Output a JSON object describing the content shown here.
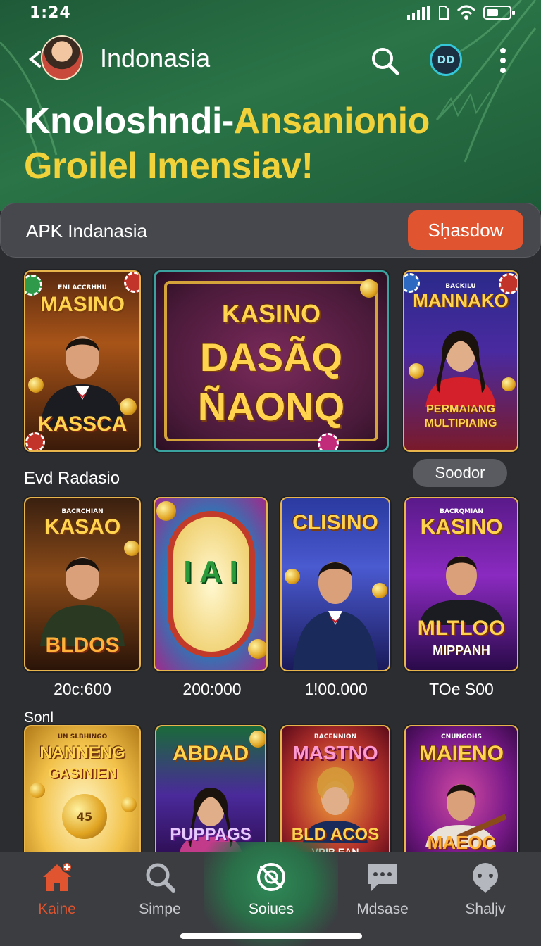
{
  "status_bar": {
    "time": "1:24"
  },
  "header": {
    "title": "Indonasia",
    "profile_initials": "DD"
  },
  "hero": {
    "line1_white": "Knoloshndi-",
    "line1_yellow": "Ansanionio",
    "line2_yellow": "Groilel Imensiav!"
  },
  "apk_bar": {
    "label": "APK Indanasia",
    "button_label": "Sḥasdow"
  },
  "featured": [
    {
      "top_small": "ENI ACCRHHU",
      "title": "MASINO",
      "bottom": "KASSCA"
    },
    {
      "title": "KASINO",
      "line2": "DASÃQ",
      "line3": "ÑAONQ"
    },
    {
      "top_small": "BACKILU",
      "title": "MANNAKO",
      "bottom": "PERMAIANG MULTIPIAING"
    }
  ],
  "section1": {
    "label": "Evd Radasio",
    "button_label": "Soodor",
    "games": [
      {
        "top_small": "BACRCHIAN",
        "title": "KASAO",
        "bottom": "BLDOS",
        "value": "20c:600"
      },
      {
        "title": "I A I",
        "value": "200:000"
      },
      {
        "title": "CLISINO",
        "value": "1!00.000"
      },
      {
        "top_small": "BACRQMIAN",
        "title": "KASINO",
        "bottom": "MLTLOO",
        "bottom2": "MIPPANH",
        "value": "TOe S00"
      }
    ]
  },
  "section2": {
    "label": "Sonl",
    "games": [
      {
        "top_small": "UN SLBHINGO",
        "title": "NANNENG",
        "sub": "GASINIEN",
        "coin_text": "45"
      },
      {
        "title": "ABDAD",
        "bottom": "PUPPAGS"
      },
      {
        "top_small": "BACENNION",
        "title": "MASTNO",
        "bottom": "BLD ACOS",
        "bottom2": "VRIB EAN"
      },
      {
        "top_small": "CNUNGOHS",
        "title": "MAIENO",
        "bottom": "MAEOC"
      }
    ]
  },
  "bottom_nav": [
    {
      "label": "Kaine",
      "icon": "home-icon"
    },
    {
      "label": "Simpe",
      "icon": "search-icon"
    },
    {
      "label": "Soiues",
      "icon": "compass-icon"
    },
    {
      "label": "Mdsase",
      "icon": "chat-icon"
    },
    {
      "label": "Shaljv",
      "icon": "support-icon"
    }
  ],
  "colors": {
    "accent": "#e0542f",
    "header_green": "#2a7447",
    "hero_yellow": "#f1d23a",
    "background": "#2b2d31"
  }
}
